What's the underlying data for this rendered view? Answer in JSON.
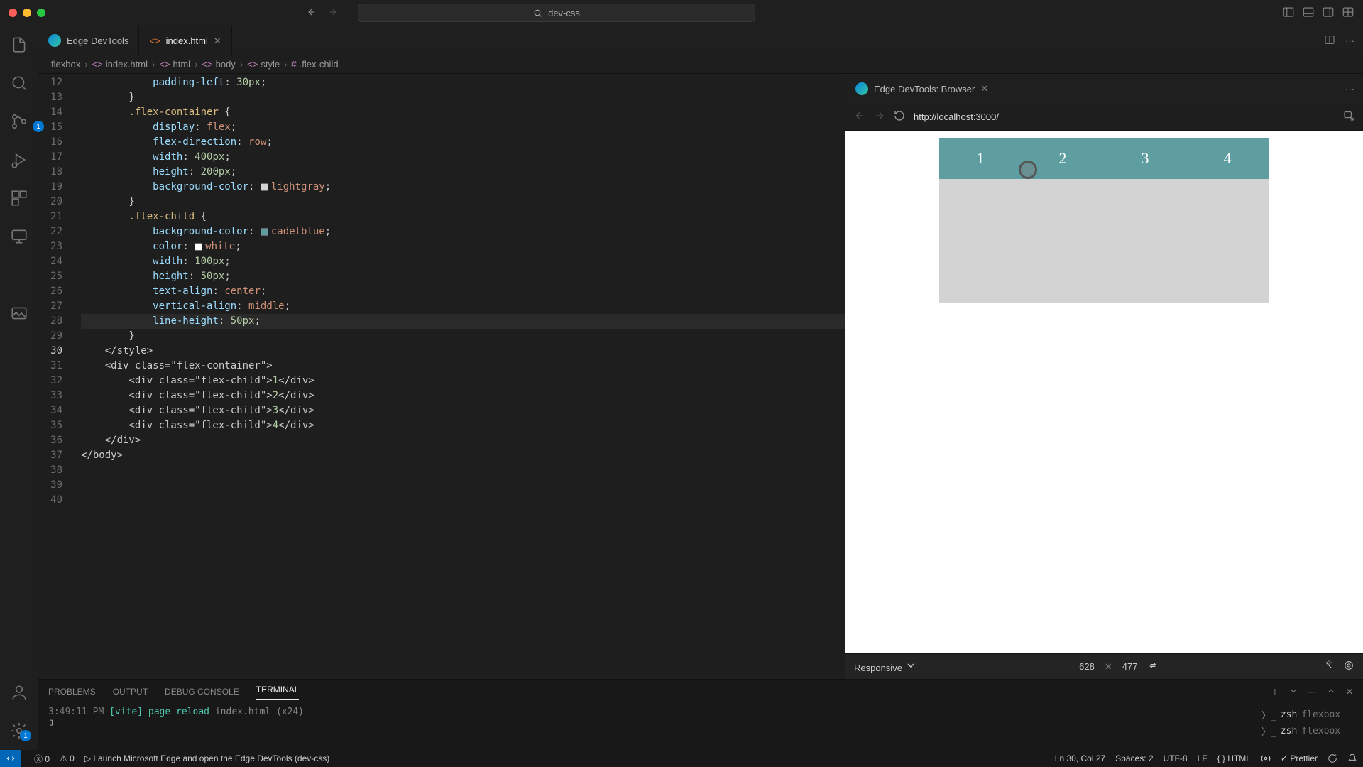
{
  "window": {
    "search": "dev-css"
  },
  "tabs": {
    "left": [
      {
        "label": "Edge DevTools",
        "active": false,
        "kind": "edge"
      },
      {
        "label": "index.html",
        "active": true,
        "kind": "html",
        "closeable": true
      }
    ],
    "right": [
      {
        "label": "Edge DevTools: Browser",
        "kind": "edge",
        "closeable": true
      }
    ]
  },
  "breadcrumb": [
    "flexbox",
    "index.html",
    "html",
    "body",
    "style",
    ".flex-child"
  ],
  "address": {
    "url": "http://localhost:3000/"
  },
  "device": {
    "mode": "Responsive",
    "w": "628",
    "h": "477"
  },
  "flex_children": [
    "1",
    "2",
    "3",
    "4"
  ],
  "code": {
    "start": 12,
    "lines": [
      "            padding-left: 30px;",
      "        }",
      "",
      "        .flex-container {",
      "            display: flex;",
      "            flex-direction: row;",
      "            width: 400px;",
      "            height: 200px;",
      "            background-color: lightgray;",
      "        }",
      "",
      "        .flex-child {",
      "            background-color: cadetblue;",
      "            color: white;",
      "            width: 100px;",
      "            height: 50px;",
      "            text-align: center;",
      "            vertical-align: middle;",
      "            line-height: 50px;",
      "        }",
      "    </style>",
      "",
      "    <div class=\"flex-container\">",
      "        <div class=\"flex-child\">1</div>",
      "        <div class=\"flex-child\">2</div>",
      "        <div class=\"flex-child\">3</div>",
      "        <div class=\"flex-child\">4</div>",
      "    </div>",
      "</body>"
    ],
    "current_line": 30
  },
  "panel": {
    "tabs": [
      "PROBLEMS",
      "OUTPUT",
      "DEBUG CONSOLE",
      "TERMINAL"
    ],
    "active": 3,
    "term_time": "3:49:11 PM",
    "term_tag": "[vite]",
    "term_msg1": "page",
    "term_msg2": "reload",
    "term_file": "index.html",
    "term_count": "(x24)",
    "shells": [
      {
        "name": "zsh",
        "cwd": "flexbox"
      },
      {
        "name": "zsh",
        "cwd": "flexbox"
      }
    ]
  },
  "status": {
    "errors": "0",
    "warnings": "0",
    "launch": "Launch Microsoft Edge and open the Edge DevTools (dev-css)",
    "pos": "Ln 30, Col 27",
    "spaces": "Spaces: 2",
    "enc": "UTF-8",
    "eol": "LF",
    "lang": "HTML",
    "prettier": "Prettier"
  },
  "activity_badge": "1"
}
